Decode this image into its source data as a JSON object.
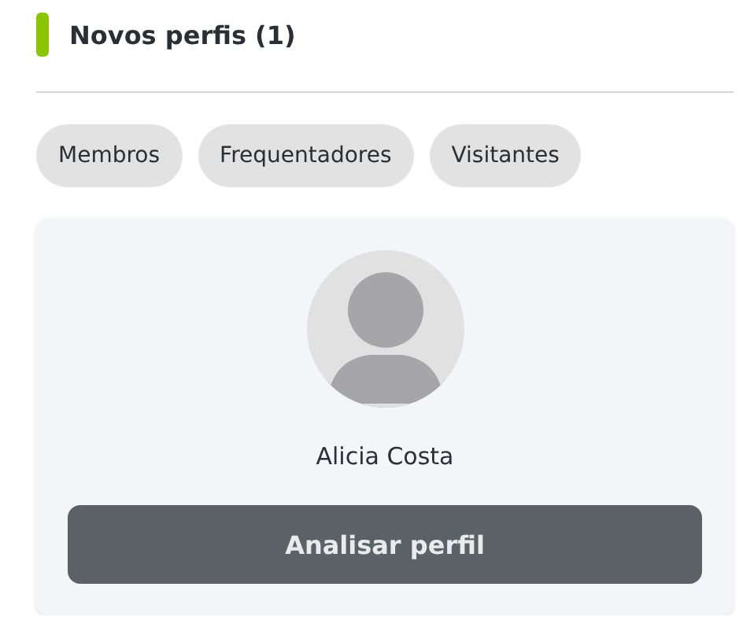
{
  "section": {
    "title": "Novos perfis (1)"
  },
  "filters": [
    {
      "label": "Membros",
      "selected": false
    },
    {
      "label": "Frequentadores",
      "selected": false
    },
    {
      "label": "Visitantes",
      "selected": false
    }
  ],
  "profile_card": {
    "name": "Alicia Costa",
    "action": "Analisar perfil"
  }
}
